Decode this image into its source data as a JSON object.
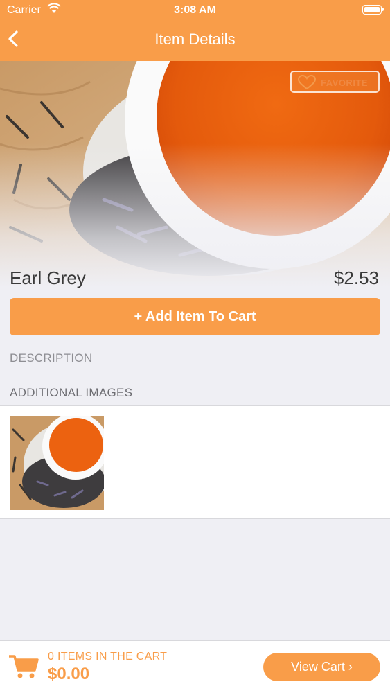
{
  "status_bar": {
    "carrier": "Carrier",
    "time": "3:08 AM"
  },
  "nav": {
    "title": "Item Details",
    "back_icon": "chevron-left-icon"
  },
  "hero": {
    "favorite_label": "FAVORITE",
    "favorite_icon": "heart-icon"
  },
  "item": {
    "name": "Earl Grey",
    "price": "$2.53"
  },
  "actions": {
    "add_to_cart_label": "+ Add Item To Cart"
  },
  "sections": {
    "description_label": "DESCRIPTION",
    "additional_images_label": "ADDITIONAL IMAGES"
  },
  "cart": {
    "items_label": "0 ITEMS IN THE CART",
    "total": "$0.00",
    "view_cart_label": "View Cart ›",
    "icon": "cart-icon"
  },
  "colors": {
    "accent": "#f99d49",
    "background": "#efeff4"
  }
}
